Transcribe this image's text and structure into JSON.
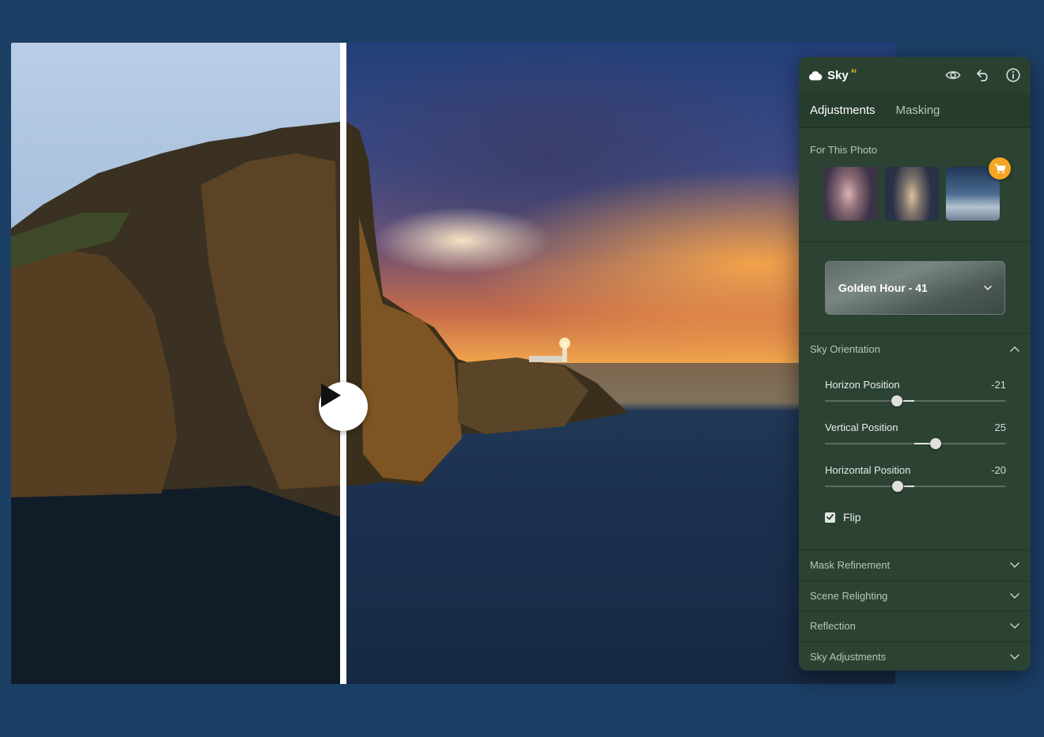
{
  "photo": {
    "compare_button": "play-icon"
  },
  "panel": {
    "title": "Sky",
    "title_badge": "AI",
    "header_icons": [
      "eye-icon",
      "undo-icon",
      "info-icon"
    ],
    "tabs": [
      {
        "label": "Adjustments",
        "active": true
      },
      {
        "label": "Masking",
        "active": false
      }
    ],
    "for_this_photo": {
      "label": "For This Photo",
      "cart_icon": "cart-icon",
      "accent_color": "#f5a623"
    },
    "preset": {
      "name": "Golden Hour - 41"
    },
    "sky_orientation": {
      "label": "Sky Orientation",
      "sliders": [
        {
          "label": "Horizon Position",
          "value": "-21",
          "level": -21
        },
        {
          "label": "Vertical Position",
          "value": "25",
          "level": 25
        },
        {
          "label": "Horizontal Position",
          "value": "-20",
          "level": -20
        }
      ],
      "flip": {
        "label": "Flip",
        "checked": true
      }
    },
    "sections": [
      {
        "label": "Mask Refinement"
      },
      {
        "label": "Scene Relighting"
      },
      {
        "label": "Reflection"
      },
      {
        "label": "Sky Adjustments"
      }
    ]
  }
}
